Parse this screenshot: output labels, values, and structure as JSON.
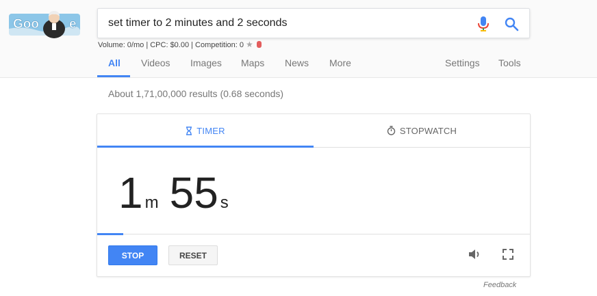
{
  "logo": {
    "text": "Google"
  },
  "search": {
    "query": "set timer to 2 minutes and 2 seconds"
  },
  "keyword_bar": {
    "text": "Volume: 0/mo | CPC: $0.00 | Competition: 0"
  },
  "nav": {
    "tabs": [
      {
        "label": "All"
      },
      {
        "label": "Videos"
      },
      {
        "label": "Images"
      },
      {
        "label": "Maps"
      },
      {
        "label": "News"
      },
      {
        "label": "More"
      }
    ],
    "settings": "Settings",
    "tools": "Tools"
  },
  "results": {
    "stats": "About 1,71,00,000 results (0.68 seconds)"
  },
  "timer": {
    "tab_timer": "TIMER",
    "tab_stopwatch": "STOPWATCH",
    "minutes": "1",
    "minutes_unit": "m",
    "seconds": "55",
    "seconds_unit": "s",
    "progress_fraction": 0.06,
    "stop_label": "STOP",
    "reset_label": "RESET"
  },
  "feedback": "Feedback",
  "colors": {
    "accent": "#4285f4",
    "mic_red": "#ea4335"
  }
}
